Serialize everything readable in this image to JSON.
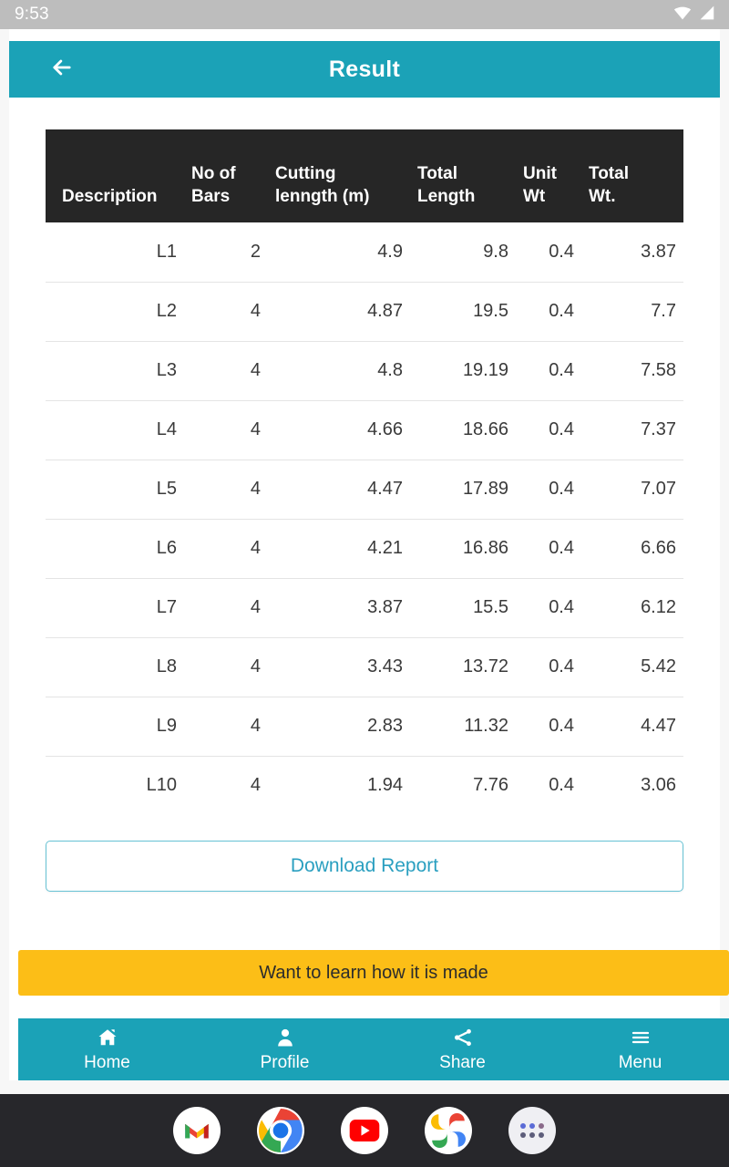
{
  "status_bar": {
    "clock": "9:53",
    "icons": [
      "wifi-icon",
      "signal-icon"
    ]
  },
  "app_bar": {
    "title": "Result",
    "back_icon": "arrow-left-icon"
  },
  "table": {
    "columns": [
      {
        "line1": "",
        "line2": "Description"
      },
      {
        "line1": "No of",
        "line2": "Bars"
      },
      {
        "line1": "Cutting",
        "line2": "lenngth (m)"
      },
      {
        "line1": "Total",
        "line2": "Length"
      },
      {
        "line1": "Unit",
        "line2": "Wt"
      },
      {
        "line1": "Total",
        "line2": "Wt."
      }
    ],
    "rows": [
      {
        "description": "L1",
        "no_of_bars": "2",
        "cutting_length": "4.9",
        "total_length": "9.8",
        "unit_wt": "0.4",
        "total_wt": "3.87"
      },
      {
        "description": "L2",
        "no_of_bars": "4",
        "cutting_length": "4.87",
        "total_length": "19.5",
        "unit_wt": "0.4",
        "total_wt": "7.7"
      },
      {
        "description": "L3",
        "no_of_bars": "4",
        "cutting_length": "4.8",
        "total_length": "19.19",
        "unit_wt": "0.4",
        "total_wt": "7.58"
      },
      {
        "description": "L4",
        "no_of_bars": "4",
        "cutting_length": "4.66",
        "total_length": "18.66",
        "unit_wt": "0.4",
        "total_wt": "7.37"
      },
      {
        "description": "L5",
        "no_of_bars": "4",
        "cutting_length": "4.47",
        "total_length": "17.89",
        "unit_wt": "0.4",
        "total_wt": "7.07"
      },
      {
        "description": "L6",
        "no_of_bars": "4",
        "cutting_length": "4.21",
        "total_length": "16.86",
        "unit_wt": "0.4",
        "total_wt": "6.66"
      },
      {
        "description": "L7",
        "no_of_bars": "4",
        "cutting_length": "3.87",
        "total_length": "15.5",
        "unit_wt": "0.4",
        "total_wt": "6.12"
      },
      {
        "description": "L8",
        "no_of_bars": "4",
        "cutting_length": "3.43",
        "total_length": "13.72",
        "unit_wt": "0.4",
        "total_wt": "5.42"
      },
      {
        "description": "L9",
        "no_of_bars": "4",
        "cutting_length": "2.83",
        "total_length": "11.32",
        "unit_wt": "0.4",
        "total_wt": "4.47"
      },
      {
        "description": "L10",
        "no_of_bars": "4",
        "cutting_length": "1.94",
        "total_length": "7.76",
        "unit_wt": "0.4",
        "total_wt": "3.06"
      }
    ]
  },
  "actions": {
    "download_report_label": "Download Report"
  },
  "promo": {
    "label": "Want to learn how it is made"
  },
  "bottom_nav": {
    "items": [
      {
        "label": "Home",
        "icon": "home-icon"
      },
      {
        "label": "Profile",
        "icon": "person-icon"
      },
      {
        "label": "Share",
        "icon": "share-icon"
      },
      {
        "label": "Menu",
        "icon": "hamburger-menu-icon"
      }
    ]
  },
  "dock": {
    "items": [
      {
        "name": "gmail-icon"
      },
      {
        "name": "chrome-icon"
      },
      {
        "name": "youtube-icon"
      },
      {
        "name": "google-photos-icon"
      },
      {
        "name": "app-drawer-icon"
      }
    ]
  },
  "colors": {
    "teal": "#1ba2b7",
    "yellow": "#fcbe17",
    "table_header": "#262626",
    "link_blue": "#2a9fc0",
    "status_bar": "#bdbdbd"
  }
}
